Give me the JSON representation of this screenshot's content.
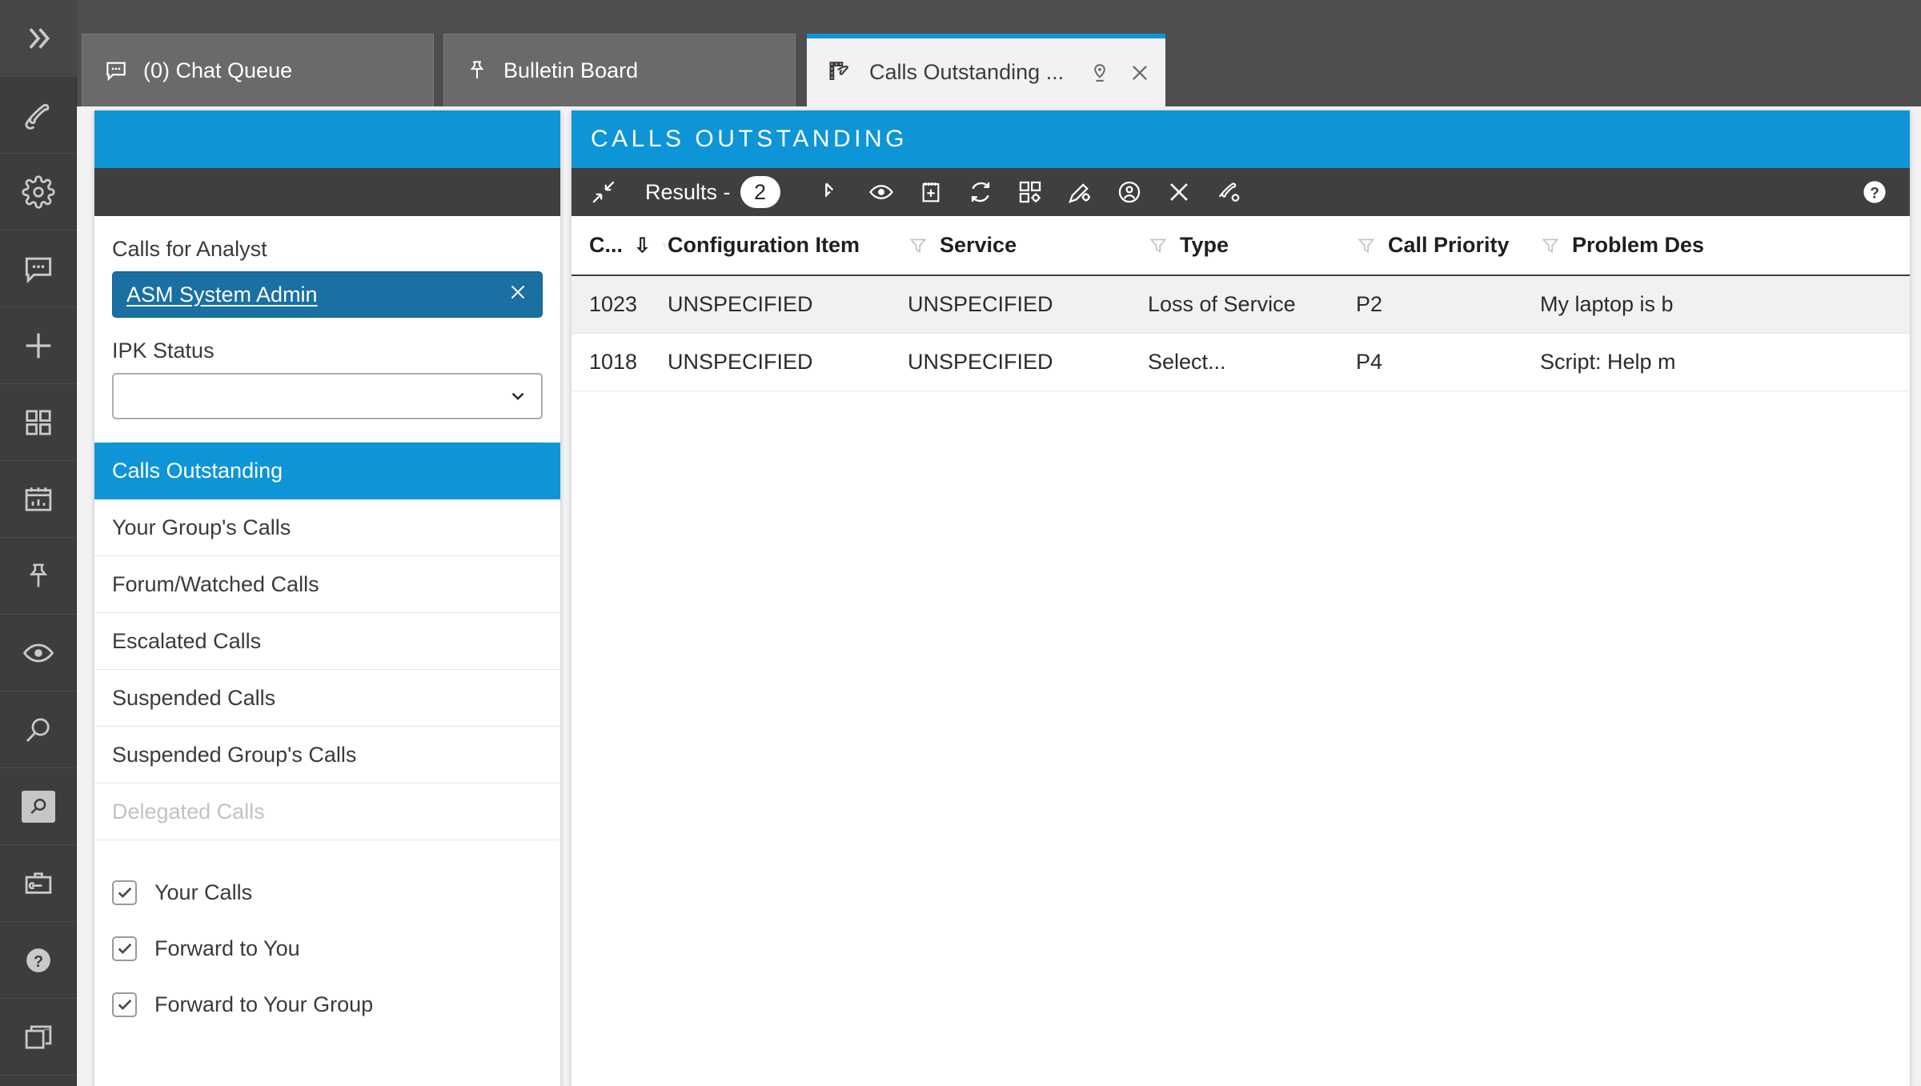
{
  "topbar": {
    "logo_icon": "brand-logo-icon",
    "avatar_icon": "avatar",
    "box1_icon": "topbar-field-1",
    "box2_icon": "topbar-field-2"
  },
  "rail": {
    "items": [
      {
        "icon": "chevron-double-right-icon",
        "name": "expand-rail-button"
      },
      {
        "icon": "phone-icon",
        "name": "rail-item-calls"
      },
      {
        "icon": "gear-icon",
        "name": "rail-item-settings"
      },
      {
        "icon": "chat-bubble-icon",
        "name": "rail-item-chat"
      },
      {
        "icon": "plus-icon",
        "name": "rail-item-new"
      },
      {
        "icon": "grid-icon",
        "name": "rail-item-dashboard"
      },
      {
        "icon": "calendar-chart-icon",
        "name": "rail-item-reports"
      },
      {
        "icon": "pin-icon",
        "name": "rail-item-bulletin"
      },
      {
        "icon": "eye-icon",
        "name": "rail-item-watched"
      },
      {
        "icon": "search-icon",
        "name": "rail-item-search"
      },
      {
        "icon": "search-box-icon",
        "name": "rail-item-advanced-search"
      },
      {
        "icon": "toolbox-icon",
        "name": "rail-item-tools"
      },
      {
        "icon": "help-circle-icon",
        "name": "rail-item-help"
      },
      {
        "icon": "windows-icon",
        "name": "rail-item-windows"
      }
    ]
  },
  "tabs": [
    {
      "label": "(0) Chat Queue",
      "icon": "chat-bubble-icon",
      "active": false
    },
    {
      "label": "Bulletin Board",
      "icon": "pin-icon",
      "active": false
    },
    {
      "label": "Calls Outstanding ...",
      "icon": "calls-outstanding-icon",
      "active": true,
      "pin_icon": "location-pin-icon",
      "close_icon": "close-icon"
    }
  ],
  "left_panel": {
    "header_title": "",
    "analyst_field": {
      "label": "Calls for Analyst",
      "value": "ASM System Admin",
      "clear_icon": "close-icon"
    },
    "ipk_field": {
      "label": "IPK Status",
      "value": "",
      "placeholder": "",
      "chevron_icon": "chevron-down-icon"
    },
    "nav_items": [
      {
        "label": "Calls Outstanding",
        "state": "selected"
      },
      {
        "label": "Your Group's Calls",
        "state": "normal"
      },
      {
        "label": "Forum/Watched Calls",
        "state": "normal"
      },
      {
        "label": "Escalated Calls",
        "state": "normal"
      },
      {
        "label": "Suspended Calls",
        "state": "normal"
      },
      {
        "label": "Suspended Group's Calls",
        "state": "normal"
      },
      {
        "label": "Delegated Calls",
        "state": "disabled"
      }
    ],
    "checkboxes": [
      {
        "label": "Your Calls",
        "checked": true
      },
      {
        "label": "Forward to You",
        "checked": true
      },
      {
        "label": "Forward to Your Group",
        "checked": true
      }
    ]
  },
  "right_panel": {
    "title": "CALLS OUTSTANDING",
    "toolbar": {
      "collapse_icon": "collapse-arrows-icon",
      "results_label": "Results -",
      "results_count": "2",
      "icons": [
        {
          "name": "pointer-select-icon"
        },
        {
          "name": "eye-icon"
        },
        {
          "name": "notepad-add-icon"
        },
        {
          "name": "refresh-icon"
        },
        {
          "name": "grid-settings-icon"
        },
        {
          "name": "pencil-settings-icon"
        },
        {
          "name": "person-circle-icon"
        },
        {
          "name": "close-x-icon"
        },
        {
          "name": "phone-settings-icon"
        }
      ],
      "help_icon": "help-circle-icon"
    },
    "table": {
      "columns": [
        {
          "label": "C...",
          "sort": "desc",
          "filter": true
        },
        {
          "label": "Configuration Item",
          "sort": "none",
          "filter": true
        },
        {
          "label": "Service",
          "sort": "none",
          "filter": true
        },
        {
          "label": "Type",
          "sort": "none",
          "filter": true
        },
        {
          "label": "Call Priority",
          "sort": "none",
          "filter": true
        },
        {
          "label": "Problem Des",
          "sort": "none",
          "filter": false
        }
      ],
      "rows": [
        {
          "highlighted": true,
          "cells": [
            "1023",
            "UNSPECIFIED",
            "UNSPECIFIED",
            "Loss of Service",
            "P2",
            "My laptop is b"
          ]
        },
        {
          "highlighted": false,
          "cells": [
            "1018",
            "UNSPECIFIED",
            "UNSPECIFIED",
            "Select...",
            "P4",
            "Script: Help m"
          ]
        }
      ]
    }
  },
  "colors": {
    "brand_blue": "#0d95d8",
    "dark_chrome": "#3d3d3d",
    "toolbar_dark": "#3f3f3f",
    "token_blue": "#1a6fa3",
    "tab_inactive": "#6a6a6a",
    "row_highlight": "#f1f1f1"
  }
}
